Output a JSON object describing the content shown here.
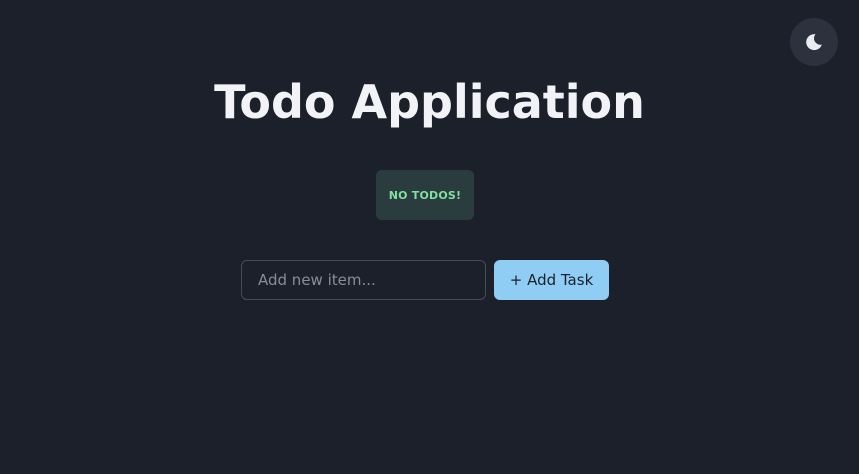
{
  "app": {
    "title": "Todo Application"
  },
  "theme_toggle": {
    "icon": "moon-icon"
  },
  "status": {
    "empty_message": "NO TODOS!"
  },
  "new_task": {
    "value": "",
    "placeholder": "Add new item...",
    "add_label": "+ Add Task"
  },
  "colors": {
    "background": "#1c202b",
    "title": "#f1f3f6",
    "toggle_background": "#2c313e",
    "badge_background": "#2b3c3e",
    "badge_text": "#7ee29e",
    "input_border": "#454b5a",
    "button_background": "#90cdf4",
    "button_text": "#1a202c"
  }
}
